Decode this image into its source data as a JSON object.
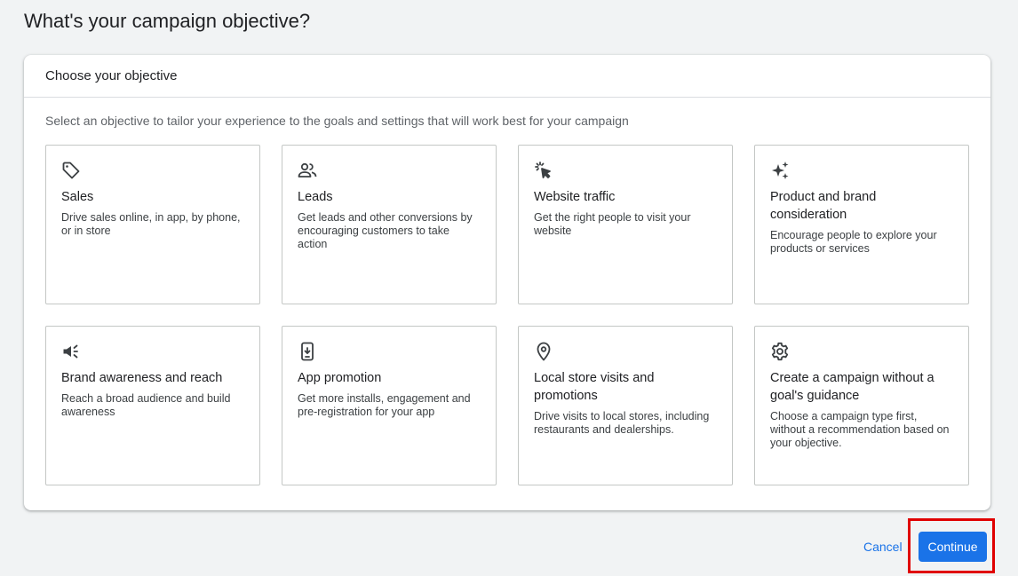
{
  "page_title": "What's your campaign objective?",
  "card": {
    "header": "Choose your objective",
    "description": "Select an objective to tailor your experience to the goals and settings that will work best for your campaign"
  },
  "objectives": [
    {
      "icon": "tag-icon",
      "title": "Sales",
      "description": "Drive sales online, in app, by phone, or in store"
    },
    {
      "icon": "people-icon",
      "title": "Leads",
      "description": "Get leads and other conversions by encouraging customers to take action"
    },
    {
      "icon": "cursor-click-icon",
      "title": "Website traffic",
      "description": "Get the right people to visit your website"
    },
    {
      "icon": "sparkle-icon",
      "title": "Product and brand consideration",
      "description": "Encourage people to explore your products or services"
    },
    {
      "icon": "megaphone-icon",
      "title": "Brand awareness and reach",
      "description": "Reach a broad audience and build awareness"
    },
    {
      "icon": "phone-download-icon",
      "title": "App promotion",
      "description": "Get more installs, engagement and pre-registration for your app"
    },
    {
      "icon": "location-pin-icon",
      "title": "Local store visits and promotions",
      "description": "Drive visits to local stores, including restaurants and dealerships."
    },
    {
      "icon": "gear-icon",
      "title": "Create a campaign without a goal's guidance",
      "description": "Choose a campaign type first, without a recommendation based on your objective."
    }
  ],
  "footer": {
    "cancel_label": "Cancel",
    "continue_label": "Continue"
  },
  "colors": {
    "primary": "#1a73e8",
    "highlight": "#e00000",
    "background": "#f1f3f4"
  }
}
